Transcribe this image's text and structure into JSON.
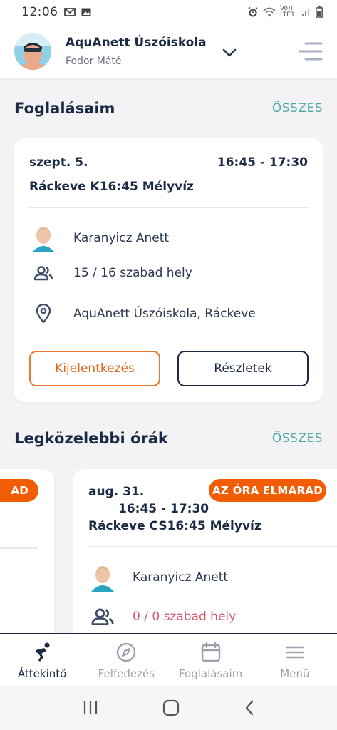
{
  "status_bar": {
    "time": "12:06",
    "network": "Vo)) LTE1"
  },
  "header": {
    "school": "AquAnett Úszóiskola",
    "user": "Fodor Máté"
  },
  "bookings": {
    "title": "Foglalásaim",
    "all_link": "ÖSSZES",
    "card": {
      "date": "szept. 5.",
      "time": "16:45 - 17:30",
      "name": "Ráckeve K16:45 Mélyvíz",
      "instructor": "Karanyicz Anett",
      "spots": "15 / 16 szabad hely",
      "location": "AquAnett Úszóiskola, Ráckeve",
      "cancel_label": "Kijelentkezés",
      "details_label": "Részletek"
    }
  },
  "upcoming": {
    "title": "Legközelebbi órák",
    "all_link": "ÖSSZES",
    "left_card": {
      "badge": "AD"
    },
    "card": {
      "badge": "AZ ÓRA ELMARAD",
      "date": "aug. 31.",
      "time": "16:45 - 17:30",
      "name": "Ráckeve CS16:45 Mélyvíz",
      "instructor": "Karanyicz Anett",
      "spots": "0 / 0 szabad hely"
    }
  },
  "bottom_nav": {
    "items": [
      {
        "label": "Áttekintő",
        "icon": "swimmer-icon",
        "active": true
      },
      {
        "label": "Felfedezés",
        "icon": "compass-icon",
        "active": false
      },
      {
        "label": "Foglalásaim",
        "icon": "calendar-icon",
        "active": false
      },
      {
        "label": "Menü",
        "icon": "hamburger-icon",
        "active": false
      }
    ]
  },
  "colors": {
    "navy": "#1b2a44",
    "teal": "#4aa9a4",
    "orange": "#e3661c",
    "badge": "#f25c05",
    "warning_text": "#d7556b"
  }
}
